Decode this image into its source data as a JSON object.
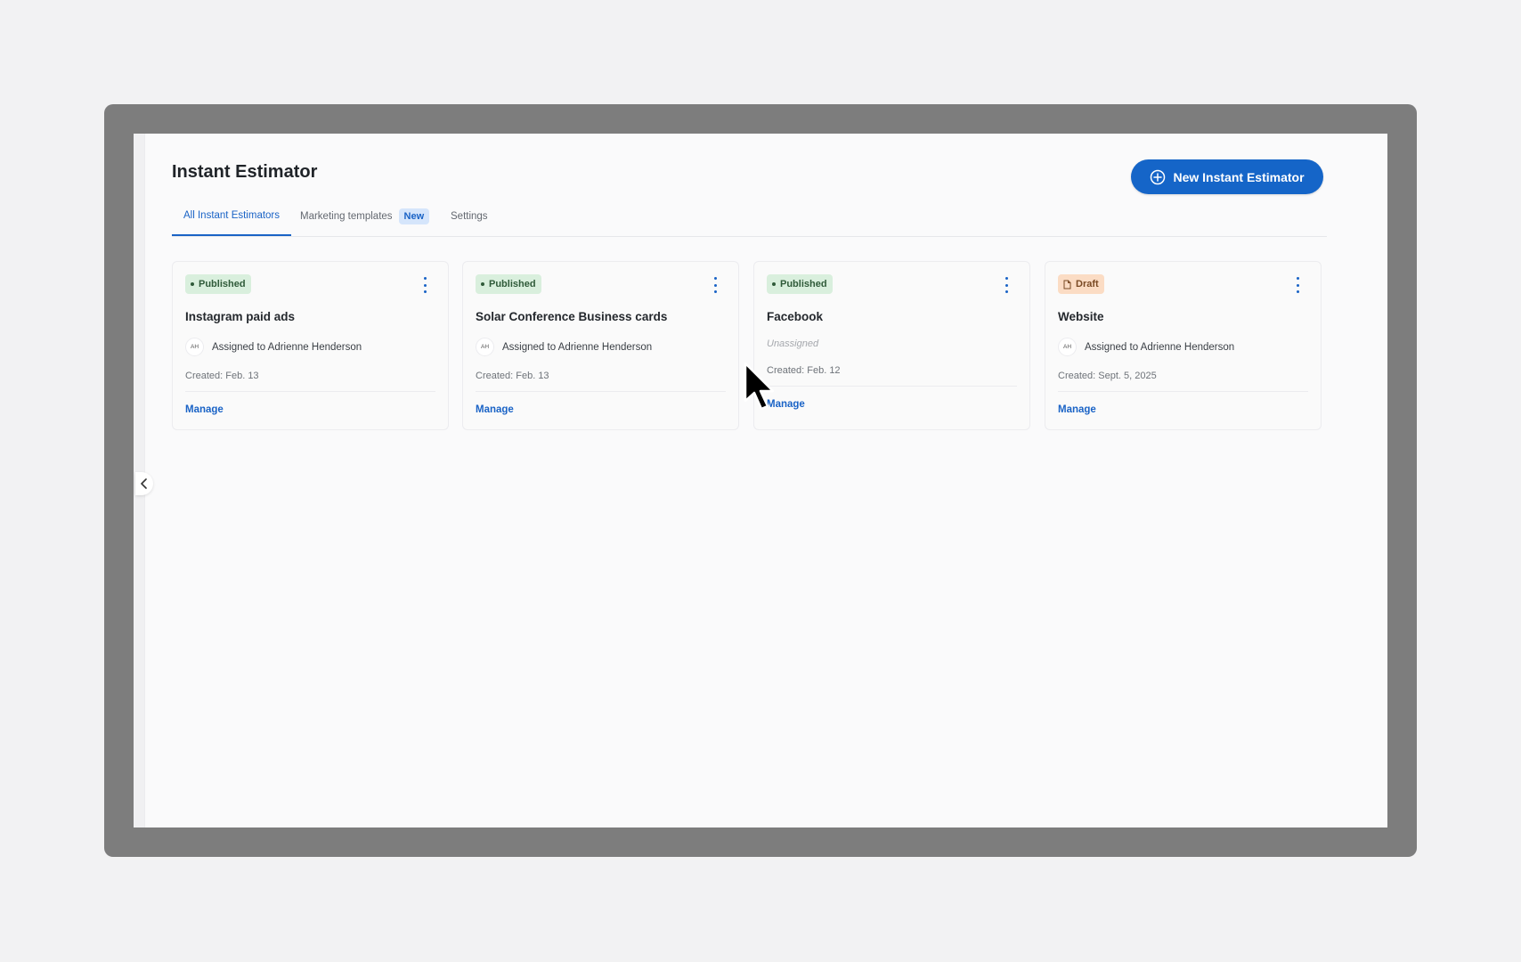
{
  "header": {
    "title": "Instant Estimator",
    "new_button_label": "New Instant Estimator"
  },
  "tabs": [
    {
      "label": "All Instant Estimators",
      "active": true
    },
    {
      "label": "Marketing templates",
      "badge": "New",
      "active": false
    },
    {
      "label": "Settings",
      "active": false
    }
  ],
  "cards": [
    {
      "status": "Published",
      "title": "Instagram paid ads",
      "avatar_initials": "AH",
      "assigned": "Assigned to Adrienne Henderson",
      "created": "Created: Feb. 13",
      "action": "Manage"
    },
    {
      "status": "Published",
      "title": "Solar Conference Business cards",
      "avatar_initials": "AH",
      "assigned": "Assigned to Adrienne Henderson",
      "created": "Created: Feb. 13",
      "action": "Manage"
    },
    {
      "status": "Published",
      "title": "Facebook",
      "unassigned": "Unassigned",
      "created": "Created: Feb. 12",
      "action": "Manage"
    },
    {
      "status": "Draft",
      "title": "Website",
      "avatar_initials": "AH",
      "assigned": "Assigned to Adrienne Henderson",
      "created": "Created: Sept. 5, 2025",
      "action": "Manage"
    }
  ],
  "colors": {
    "primary": "#1565c8",
    "published_bg": "#d9efdd",
    "draft_bg": "#fbdcc4",
    "frame": "#7d7d7d"
  },
  "icons": {
    "new_button": "plus-circle-icon",
    "collapse": "chevron-left-icon",
    "card_menu": "kebab-menu-icon",
    "draft_badge": "document-icon",
    "pointer": "mouse-pointer-icon"
  }
}
